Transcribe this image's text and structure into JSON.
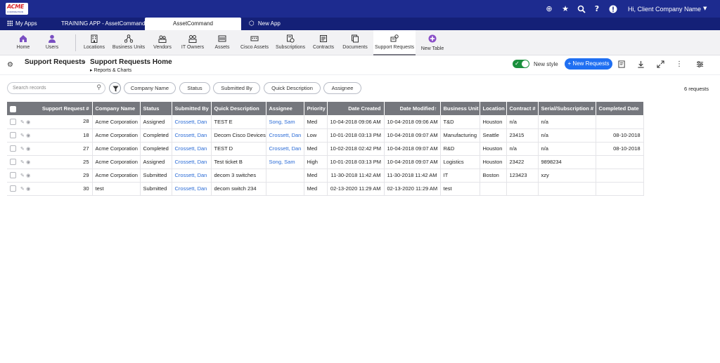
{
  "top_bar": {
    "logo_text": "ACME",
    "logo_subtext": "CORPORATION",
    "user_name": "Hi, Client Company Name"
  },
  "app_bar": {
    "tabs": [
      {
        "label": "My Apps"
      },
      {
        "label": "TRAINING APP - AssetCommand"
      },
      {
        "label": "AssetCommand"
      },
      {
        "label": "New App"
      }
    ]
  },
  "modules": [
    {
      "label": "Home",
      "icon": "home-icon",
      "color": "#7a4fc2"
    },
    {
      "label": "Users",
      "icon": "user-icon",
      "color": "#7a4fc2"
    },
    {
      "label": "Locations",
      "icon": "building-icon"
    },
    {
      "label": "Business Units",
      "icon": "hierarchy-icon"
    },
    {
      "label": "Vendors",
      "icon": "vendors-icon"
    },
    {
      "label": "IT Owners",
      "icon": "owners-icon"
    },
    {
      "label": "Assets",
      "icon": "server-icon"
    },
    {
      "label": "Cisco Assets",
      "icon": "network-icon"
    },
    {
      "label": "Subscriptions",
      "icon": "subscription-icon"
    },
    {
      "label": "Contracts",
      "icon": "contract-icon"
    },
    {
      "label": "Documents",
      "icon": "document-icon"
    },
    {
      "label": "Support Requests",
      "icon": "support-icon"
    },
    {
      "label": "New Table",
      "icon": "plus-circle-icon",
      "color": "#8a4fc8"
    }
  ],
  "title_bar": {
    "breadcrumb_parent": "Support Requests",
    "breadcrumb_current": "Support Requests Home",
    "sub_link": "Reports & Charts",
    "new_style_label": "New style",
    "new_requests_label": "+ New Requests"
  },
  "filters": {
    "search_placeholder": "Search records",
    "chips": [
      "Company Name",
      "Status",
      "Submitted By",
      "Quick Description",
      "Assignee"
    ],
    "record_count": "6 requests"
  },
  "table": {
    "columns": [
      "Support Request #",
      "Company Name",
      "Status",
      "Submitted By",
      "Quick Description",
      "Assignee",
      "Priority",
      "Date Created",
      "Date Modified",
      "Business Unit",
      "Location",
      "Contract #",
      "Serial/Subscription #",
      "Completed Date"
    ],
    "sort_indicator": "↑",
    "rows": [
      {
        "id": "28",
        "company": "Acme Corporation",
        "status": "Assigned",
        "submitted_by": "Crossett, Dan",
        "description": "TEST E",
        "assignee": "Song, Sam",
        "priority": "Med",
        "created": "10-04-2018 09:06 AM",
        "modified": "10-04-2018 09:06 AM",
        "bu": "T&D",
        "location": "Houston",
        "contract": "n/a",
        "serial": "n/a",
        "completed": ""
      },
      {
        "id": "18",
        "company": "Acme Corporation",
        "status": "Completed",
        "submitted_by": "Crossett, Dan",
        "description": "Decom Cisco Devices",
        "assignee": "Crossett, Dan",
        "priority": "Low",
        "created": "10-01-2018 03:13 PM",
        "modified": "10-04-2018 09:07 AM",
        "bu": "Manufacturing",
        "location": "Seattle",
        "contract": "23415",
        "serial": "n/a",
        "completed": "08-10-2018"
      },
      {
        "id": "27",
        "company": "Acme Corporation",
        "status": "Completed",
        "submitted_by": "Crossett, Dan",
        "description": "TEST D",
        "assignee": "Crossett, Dan",
        "priority": "Med",
        "created": "10-02-2018 02:42 PM",
        "modified": "10-04-2018 09:07 AM",
        "bu": "R&D",
        "location": "Houston",
        "contract": "n/a",
        "serial": "n/a",
        "completed": "08-10-2018"
      },
      {
        "id": "25",
        "company": "Acme Corporation",
        "status": "Assigned",
        "submitted_by": "Crossett, Dan",
        "description": "Test ticket B",
        "assignee": "Song, Sam",
        "priority": "High",
        "created": "10-01-2018 03:13 PM",
        "modified": "10-04-2018 09:07 AM",
        "bu": "Logistics",
        "location": "Houston",
        "contract": "23422",
        "serial": "9898234",
        "completed": ""
      },
      {
        "id": "29",
        "company": "Acme Corporation",
        "status": "Submitted",
        "submitted_by": "Crossett, Dan",
        "description": "decom 3 switches",
        "assignee": "",
        "priority": "Med",
        "created": "11-30-2018 11:42 AM",
        "modified": "11-30-2018 11:42 AM",
        "bu": "IT",
        "location": "Boston",
        "contract": "123423",
        "serial": "xzy",
        "completed": ""
      },
      {
        "id": "30",
        "company": "test",
        "status": "Submitted",
        "submitted_by": "Crossett, Dan",
        "description": "decom switch 234",
        "assignee": "",
        "priority": "Med",
        "created": "02-13-2020 11:29 AM",
        "modified": "02-13-2020 11:29 AM",
        "bu": "test",
        "location": "",
        "contract": "",
        "serial": "",
        "completed": ""
      }
    ]
  },
  "colors": {
    "top_bar": "#1d2b8f",
    "app_bar": "#142077",
    "header_row": "#75777d",
    "link": "#2a6bd6",
    "primary_button": "#1f6ff2",
    "toggle_on": "#1a8f3c"
  }
}
